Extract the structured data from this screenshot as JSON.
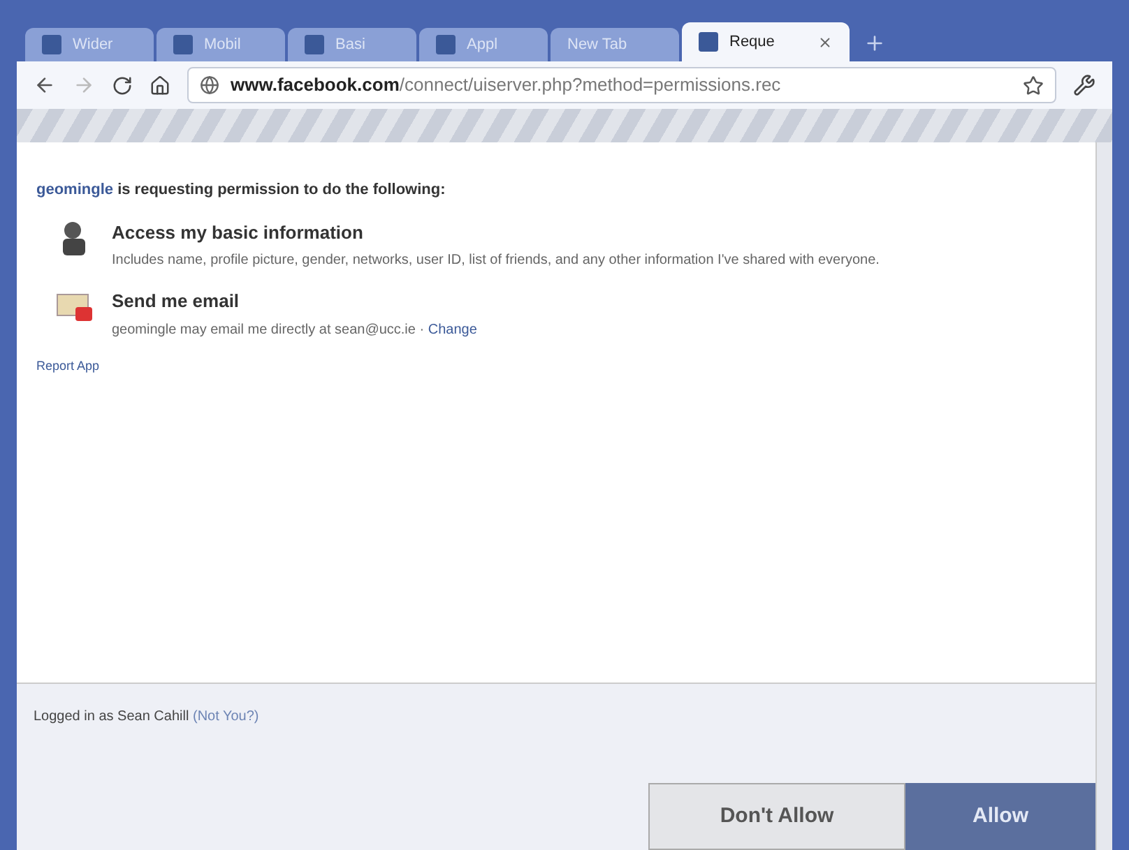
{
  "tabs": [
    {
      "label": "Wider",
      "selected": false,
      "favicon": true
    },
    {
      "label": "Mobil",
      "selected": false,
      "favicon": true
    },
    {
      "label": "Basi",
      "selected": false,
      "favicon": true
    },
    {
      "label": "Appl",
      "selected": false,
      "favicon": true
    },
    {
      "label": "New Tab",
      "selected": false,
      "favicon": false
    },
    {
      "label": "Reque",
      "selected": true,
      "favicon": true
    }
  ],
  "address_bar": {
    "domain": "www.facebook.com",
    "path": "/connect/uiserver.php?method=permissions.rec"
  },
  "dialog": {
    "app_name": "geomingle",
    "intro": " is requesting permission to do the following:",
    "permissions": [
      {
        "kind": "info",
        "title": "Access my basic information",
        "description": "Includes name, profile picture, gender, networks, user ID, list of friends, and any other information I've shared with everyone."
      },
      {
        "kind": "email",
        "title": "Send me email",
        "description": "geomingle may email me directly at sean@ucc.ie · ",
        "link": "Change"
      }
    ],
    "report_link": "Report App",
    "logged_in": "Logged in as Sean Cahill",
    "not_you": "(Not You?)",
    "buttons": [
      {
        "label": "Don't Allow",
        "kind": "secondary"
      },
      {
        "label": "Allow",
        "kind": "primary"
      }
    ]
  }
}
